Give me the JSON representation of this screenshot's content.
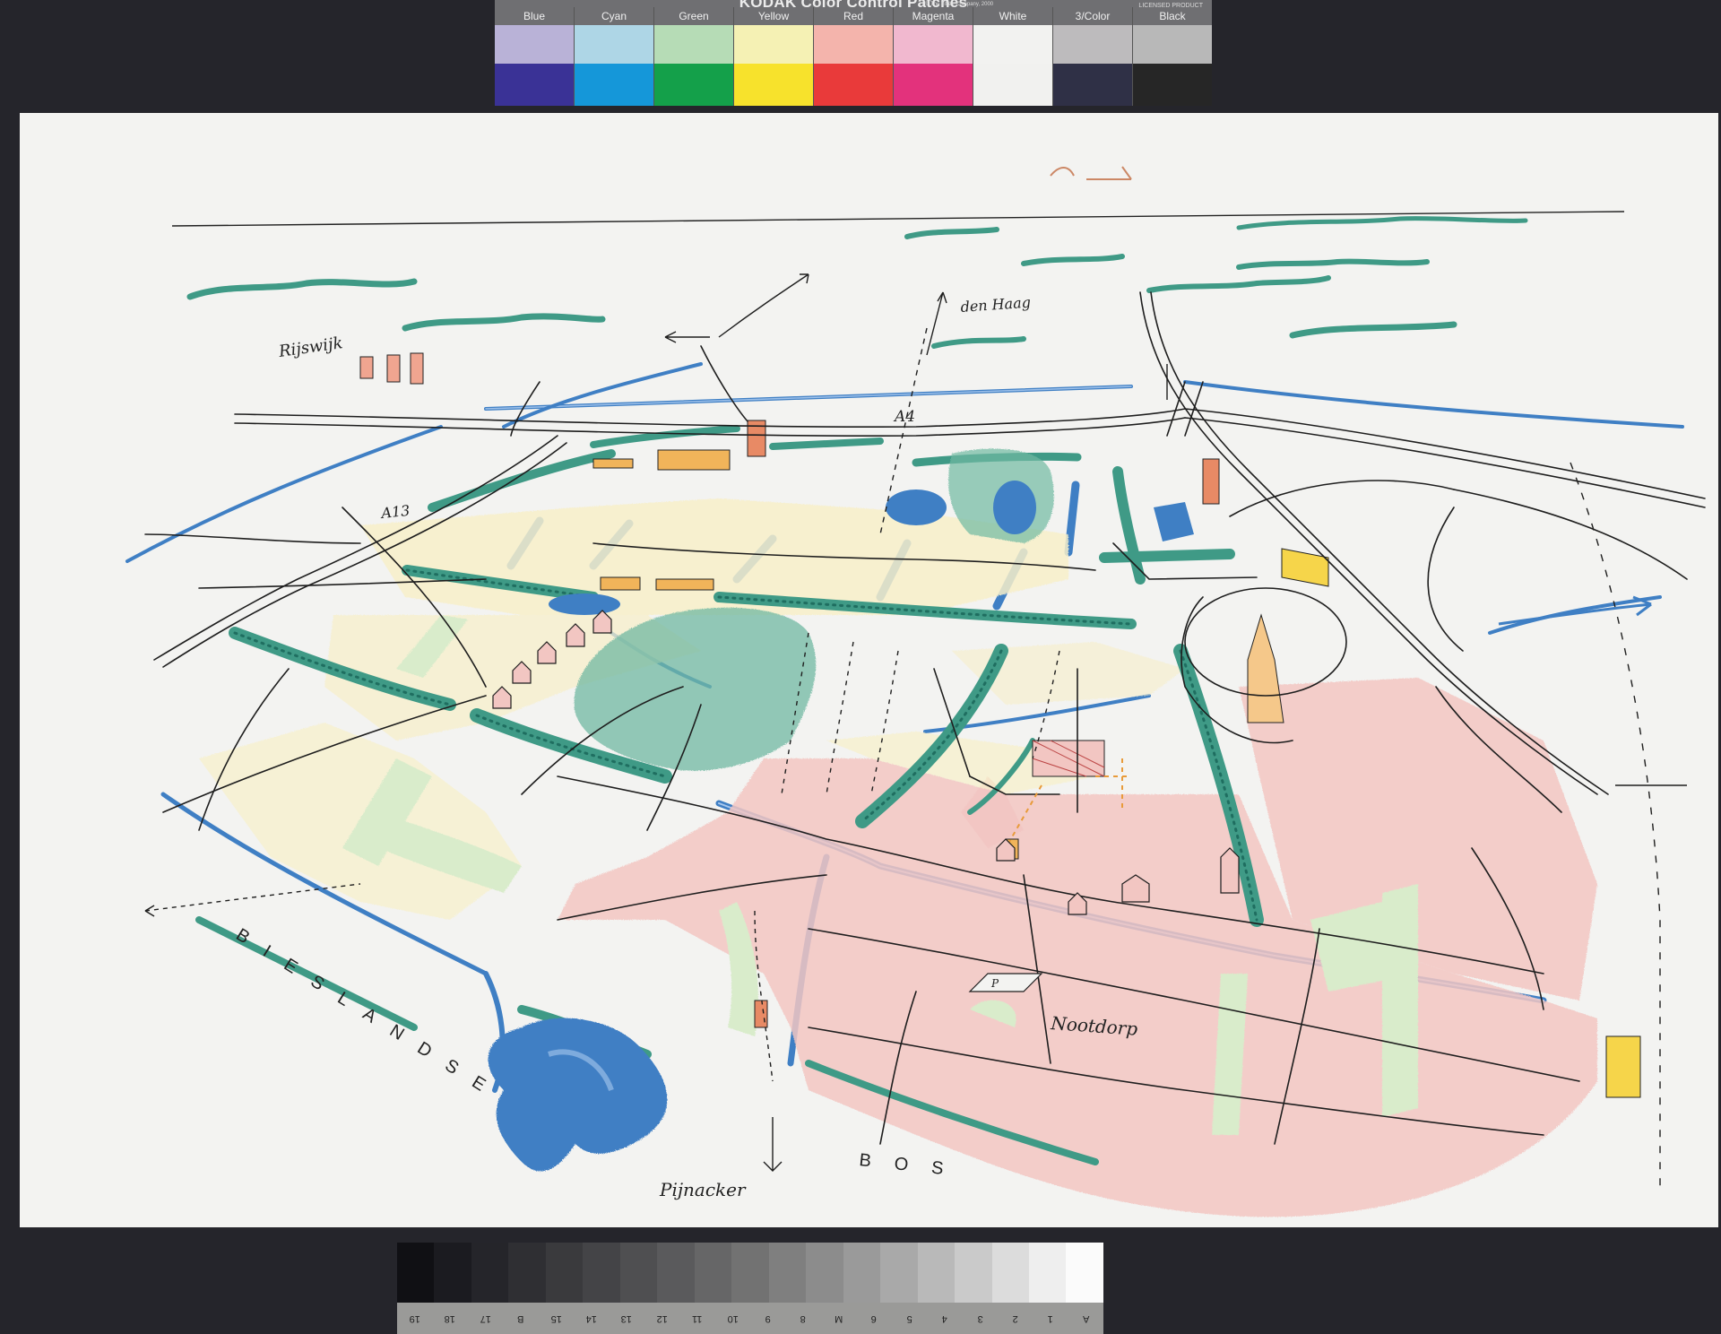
{
  "color_strip": {
    "title": "KODAK Color Control Patches",
    "copyright": "© The Tiffen Company, 2000",
    "licence": "LICENSED PRODUCT",
    "patches": [
      {
        "label": "Blue",
        "light": "#b9b2d7",
        "dark": "#3a3296"
      },
      {
        "label": "Cyan",
        "light": "#aed6e6",
        "dark": "#1597d9"
      },
      {
        "label": "Green",
        "light": "#b6dcb6",
        "dark": "#14a04a"
      },
      {
        "label": "Yellow",
        "light": "#f5f1b4",
        "dark": "#f7e22c"
      },
      {
        "label": "Red",
        "light": "#f4b4ac",
        "dark": "#e93a3a"
      },
      {
        "label": "Magenta",
        "light": "#f1b8cf",
        "dark": "#e3327c"
      },
      {
        "label": "White",
        "light": "#f2f2f0",
        "dark": "#f1f1ef"
      },
      {
        "label": "3/Color",
        "light": "#bdbbbd",
        "dark": "#2f3046"
      },
      {
        "label": "Black",
        "light": "#b8b8b8",
        "dark": "#262626"
      }
    ]
  },
  "drawing": {
    "labels": {
      "rijswijk": "Rijswijk",
      "den_haag": "den Haag",
      "a4": "A4",
      "a13": "A13",
      "nootdorp": "Nootdorp",
      "pijnacker": "Pijnacker",
      "parking": "P",
      "bieslandse": "BIESLANDSE",
      "bos": "BOS"
    },
    "palette": {
      "water": "#3f7fc4",
      "water_light": "#8fb6e6",
      "trees": "#3f9a86",
      "trees_dark": "#1f6e60",
      "residential": "#f2c6c2",
      "meadow": "#d9eccb",
      "yellow_field": "#f7efc9",
      "orange": "#f1b45a",
      "ink": "#1e1e1e"
    }
  },
  "gray_scale": {
    "steps": [
      "#101014",
      "#1b1b20",
      "#25252a",
      "#2f2f33",
      "#3a3a3d",
      "#444447",
      "#4f4f51",
      "#5a5a5c",
      "#666667",
      "#727272",
      "#7f7f7f",
      "#8c8c8c",
      "#9a9a9a",
      "#a9a9a9",
      "#b9b9b9",
      "#cacaca",
      "#dcdcdc",
      "#eeeeee",
      "#fbfbfb"
    ],
    "numbers": [
      "19",
      "18",
      "17",
      "B",
      "15",
      "14",
      "13",
      "12",
      "11",
      "10",
      "9",
      "8",
      "M",
      "6",
      "5",
      "4",
      "3",
      "2",
      "1",
      "A"
    ]
  }
}
